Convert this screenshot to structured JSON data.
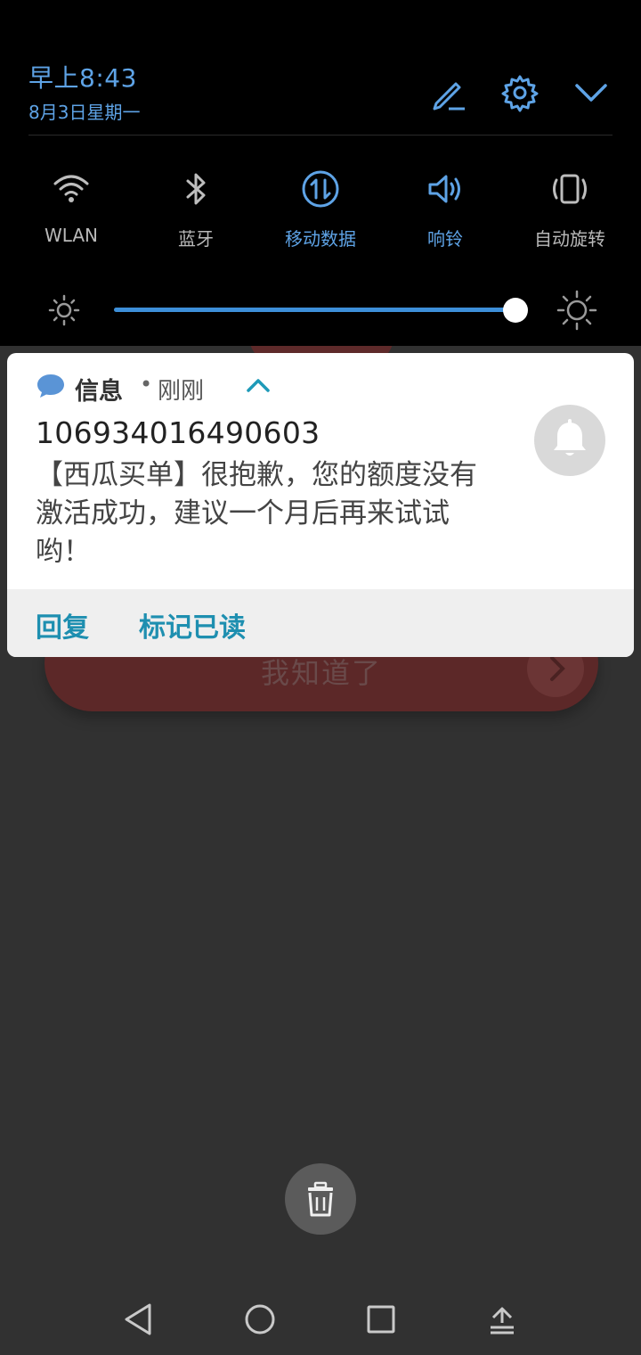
{
  "status": {
    "time": "早上8:43",
    "date": "8月3日星期一"
  },
  "header_icons": [
    "edit-icon",
    "gear-icon",
    "chevron-down-icon"
  ],
  "tiles": [
    {
      "label": "WLAN",
      "icon": "wifi-icon",
      "active": false
    },
    {
      "label": "蓝牙",
      "icon": "bluetooth-icon",
      "active": false
    },
    {
      "label": "移动数据",
      "icon": "mobile-data-icon",
      "active": true
    },
    {
      "label": "响铃",
      "icon": "speaker-icon",
      "active": true
    },
    {
      "label": "自动旋转",
      "icon": "rotate-icon",
      "active": false
    }
  ],
  "brightness": {
    "level": 0.99
  },
  "notification": {
    "app_name": "信息",
    "separator": "•",
    "time": "刚刚",
    "sender": "106934016490603",
    "body": "【西瓜买单】很抱歉，您的额度没有激活成功，建议一个月后再来试试哟！",
    "actions": {
      "reply": "回复",
      "mark_read": "标记已读"
    }
  },
  "background_app": {
    "button_label": "我知道了"
  },
  "colors": {
    "accent": "#5ea3e6",
    "action": "#1e8fb0",
    "panel": "#000000",
    "backdrop": "#313131"
  }
}
